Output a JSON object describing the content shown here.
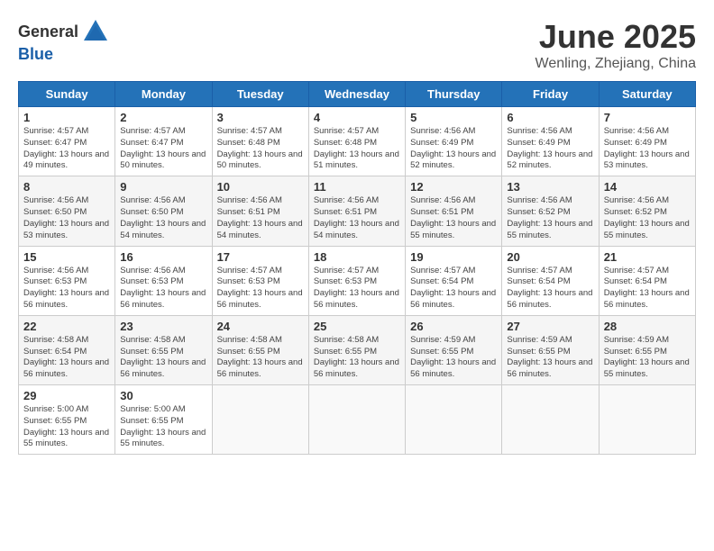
{
  "header": {
    "logo_general": "General",
    "logo_blue": "Blue",
    "month": "June 2025",
    "location": "Wenling, Zhejiang, China"
  },
  "days_of_week": [
    "Sunday",
    "Monday",
    "Tuesday",
    "Wednesday",
    "Thursday",
    "Friday",
    "Saturday"
  ],
  "weeks": [
    [
      {
        "day": "1",
        "sunrise": "4:57 AM",
        "sunset": "6:47 PM",
        "daylight": "13 hours and 49 minutes."
      },
      {
        "day": "2",
        "sunrise": "4:57 AM",
        "sunset": "6:47 PM",
        "daylight": "13 hours and 50 minutes."
      },
      {
        "day": "3",
        "sunrise": "4:57 AM",
        "sunset": "6:48 PM",
        "daylight": "13 hours and 50 minutes."
      },
      {
        "day": "4",
        "sunrise": "4:57 AM",
        "sunset": "6:48 PM",
        "daylight": "13 hours and 51 minutes."
      },
      {
        "day": "5",
        "sunrise": "4:56 AM",
        "sunset": "6:49 PM",
        "daylight": "13 hours and 52 minutes."
      },
      {
        "day": "6",
        "sunrise": "4:56 AM",
        "sunset": "6:49 PM",
        "daylight": "13 hours and 52 minutes."
      },
      {
        "day": "7",
        "sunrise": "4:56 AM",
        "sunset": "6:49 PM",
        "daylight": "13 hours and 53 minutes."
      }
    ],
    [
      {
        "day": "8",
        "sunrise": "4:56 AM",
        "sunset": "6:50 PM",
        "daylight": "13 hours and 53 minutes."
      },
      {
        "day": "9",
        "sunrise": "4:56 AM",
        "sunset": "6:50 PM",
        "daylight": "13 hours and 54 minutes."
      },
      {
        "day": "10",
        "sunrise": "4:56 AM",
        "sunset": "6:51 PM",
        "daylight": "13 hours and 54 minutes."
      },
      {
        "day": "11",
        "sunrise": "4:56 AM",
        "sunset": "6:51 PM",
        "daylight": "13 hours and 54 minutes."
      },
      {
        "day": "12",
        "sunrise": "4:56 AM",
        "sunset": "6:51 PM",
        "daylight": "13 hours and 55 minutes."
      },
      {
        "day": "13",
        "sunrise": "4:56 AM",
        "sunset": "6:52 PM",
        "daylight": "13 hours and 55 minutes."
      },
      {
        "day": "14",
        "sunrise": "4:56 AM",
        "sunset": "6:52 PM",
        "daylight": "13 hours and 55 minutes."
      }
    ],
    [
      {
        "day": "15",
        "sunrise": "4:56 AM",
        "sunset": "6:53 PM",
        "daylight": "13 hours and 56 minutes."
      },
      {
        "day": "16",
        "sunrise": "4:56 AM",
        "sunset": "6:53 PM",
        "daylight": "13 hours and 56 minutes."
      },
      {
        "day": "17",
        "sunrise": "4:57 AM",
        "sunset": "6:53 PM",
        "daylight": "13 hours and 56 minutes."
      },
      {
        "day": "18",
        "sunrise": "4:57 AM",
        "sunset": "6:53 PM",
        "daylight": "13 hours and 56 minutes."
      },
      {
        "day": "19",
        "sunrise": "4:57 AM",
        "sunset": "6:54 PM",
        "daylight": "13 hours and 56 minutes."
      },
      {
        "day": "20",
        "sunrise": "4:57 AM",
        "sunset": "6:54 PM",
        "daylight": "13 hours and 56 minutes."
      },
      {
        "day": "21",
        "sunrise": "4:57 AM",
        "sunset": "6:54 PM",
        "daylight": "13 hours and 56 minutes."
      }
    ],
    [
      {
        "day": "22",
        "sunrise": "4:58 AM",
        "sunset": "6:54 PM",
        "daylight": "13 hours and 56 minutes."
      },
      {
        "day": "23",
        "sunrise": "4:58 AM",
        "sunset": "6:55 PM",
        "daylight": "13 hours and 56 minutes."
      },
      {
        "day": "24",
        "sunrise": "4:58 AM",
        "sunset": "6:55 PM",
        "daylight": "13 hours and 56 minutes."
      },
      {
        "day": "25",
        "sunrise": "4:58 AM",
        "sunset": "6:55 PM",
        "daylight": "13 hours and 56 minutes."
      },
      {
        "day": "26",
        "sunrise": "4:59 AM",
        "sunset": "6:55 PM",
        "daylight": "13 hours and 56 minutes."
      },
      {
        "day": "27",
        "sunrise": "4:59 AM",
        "sunset": "6:55 PM",
        "daylight": "13 hours and 56 minutes."
      },
      {
        "day": "28",
        "sunrise": "4:59 AM",
        "sunset": "6:55 PM",
        "daylight": "13 hours and 55 minutes."
      }
    ],
    [
      {
        "day": "29",
        "sunrise": "5:00 AM",
        "sunset": "6:55 PM",
        "daylight": "13 hours and 55 minutes."
      },
      {
        "day": "30",
        "sunrise": "5:00 AM",
        "sunset": "6:55 PM",
        "daylight": "13 hours and 55 minutes."
      },
      null,
      null,
      null,
      null,
      null
    ]
  ]
}
